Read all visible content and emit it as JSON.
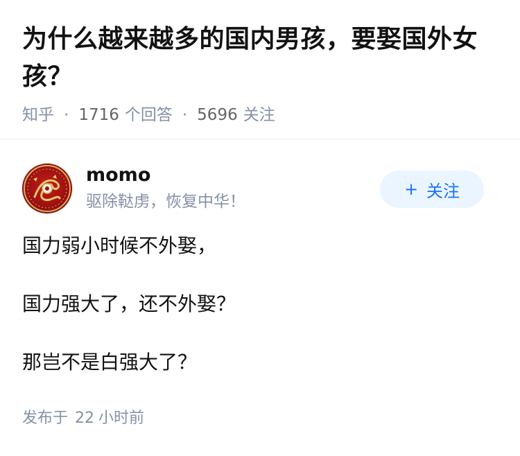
{
  "question": {
    "title": "为什么越来越多的国内男孩，要娶国外女孩？",
    "source": "知乎",
    "answer_count": "1716",
    "answer_label": "个回答",
    "follower_count": "5696",
    "follower_label": "关注"
  },
  "author": {
    "name": "momo",
    "bio": "驱除鞑虏，恢复中华！",
    "avatar_icon": "dragon-emblem-icon",
    "follow_plus": "+",
    "follow_label": "关注"
  },
  "answer": {
    "paragraphs": [
      "国力弱小时候不外娶，",
      "国力强大了，还不外娶？",
      "那岂不是白强大了？"
    ]
  },
  "footer": {
    "published_label": "发布于",
    "published_value": "22",
    "published_unit": "小时前"
  },
  "colors": {
    "accent": "#1772f6",
    "accent_bg": "#ebf5ff",
    "meta_text": "#8590a6",
    "avatar_red": "#9c1010",
    "avatar_gold": "#d6b25a"
  }
}
